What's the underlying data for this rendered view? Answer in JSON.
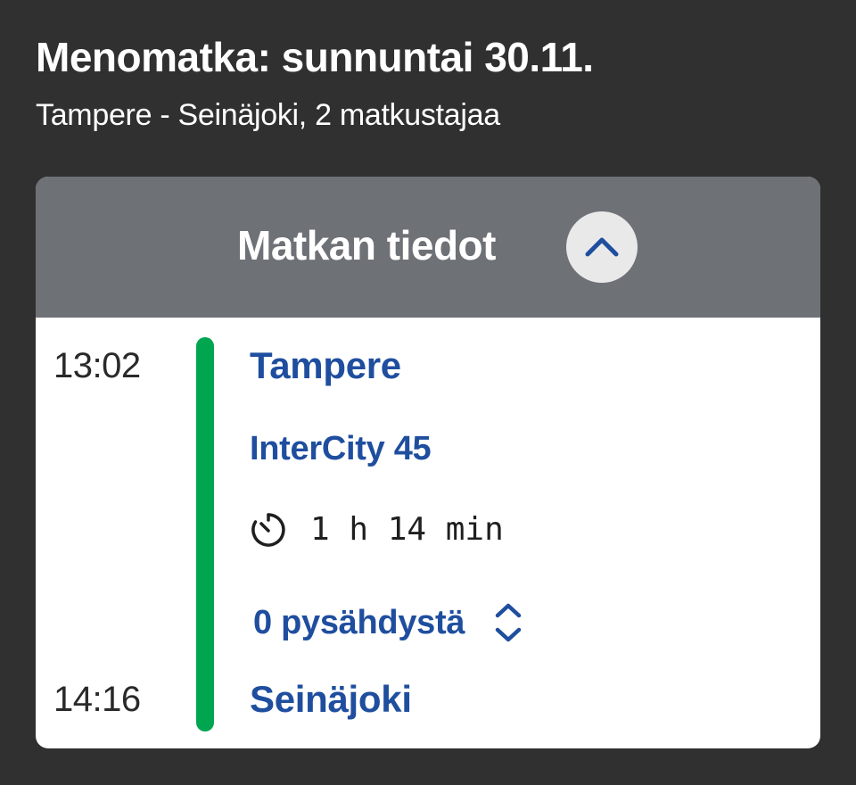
{
  "trip": {
    "title": "Menomatka: sunnuntai 30.11.",
    "subtitle": "Tampere - Seinäjoki, 2 matkustajaa"
  },
  "card": {
    "header_title": "Matkan tiedot",
    "header_toggle_icon": "chevron-up-icon",
    "departure": {
      "time": "13:02",
      "station": "Tampere"
    },
    "train": "InterCity 45",
    "duration_icon": "timer-icon",
    "duration": "1 h 14 min",
    "stops": {
      "label": "0 pysähdystä",
      "icon": "chevron-up-down-icon"
    },
    "arrival": {
      "time": "14:16",
      "station": "Seinäjoki"
    }
  },
  "colors": {
    "background": "#303030",
    "header": "#6e7176",
    "route_line": "#00a64f",
    "link_blue": "#1f4e9f"
  }
}
